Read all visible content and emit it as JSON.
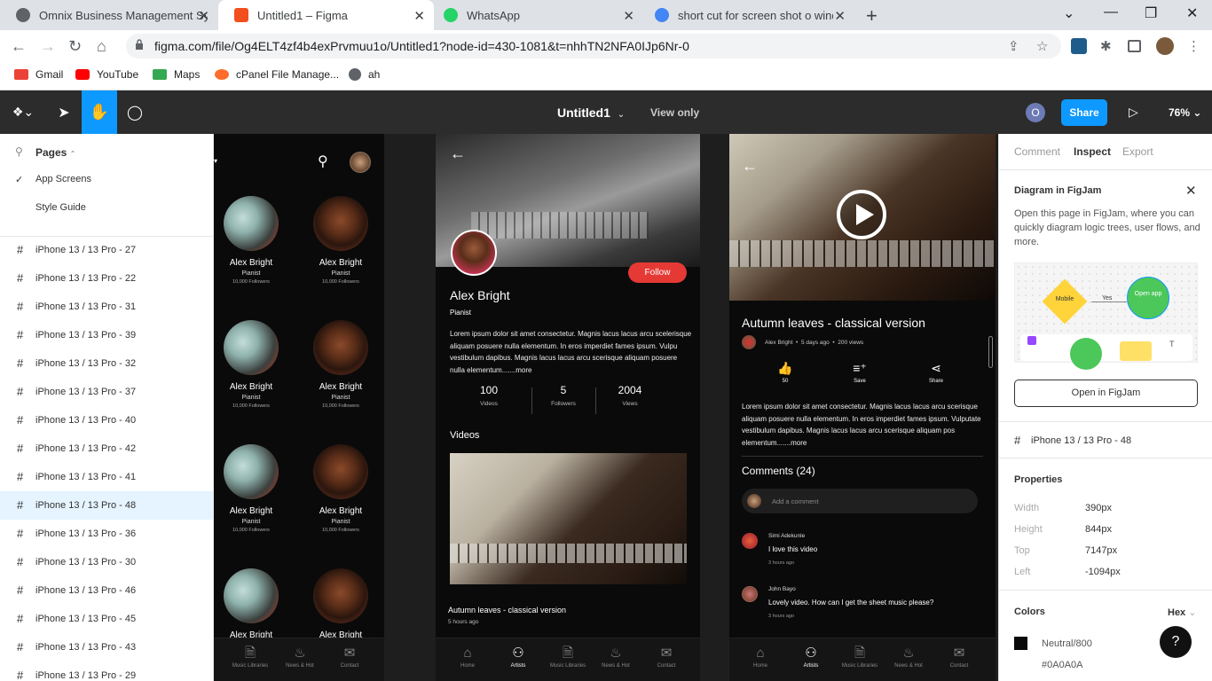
{
  "browser": {
    "tabs": [
      {
        "title": "Omnix Business Management Sy",
        "color": "#5f6368"
      },
      {
        "title": "Untitled1 – Figma",
        "color": "#f24e1e"
      },
      {
        "title": "WhatsApp",
        "color": "#25d366"
      },
      {
        "title": "short cut for screen shot o windo",
        "color": "#4285f4"
      }
    ],
    "url": "figma.com/file/Og4ELT4zf4b4exPrvmuu1o/Untitled1?node-id=430-1081&t=nhhTN2NFA0IJp6Nr-0",
    "bookmarks": [
      "Gmail",
      "YouTube",
      "Maps",
      "cPanel File Manage...",
      "ah"
    ]
  },
  "figma": {
    "file_name": "Untitled1",
    "mode": "View only",
    "avatar_initial": "O",
    "share_label": "Share",
    "zoom": "76%"
  },
  "left_panel": {
    "pages_label": "Pages",
    "pages": [
      "App Screens",
      "Style Guide"
    ],
    "frames": [
      "iPhone 13 / 13 Pro - 27",
      "iPhone 13 / 13 Pro - 22",
      "iPhone 13 / 13 Pro - 31",
      "iPhone 13 / 13 Pro - 39",
      "iPhone 13 / 13 Pro - 32",
      "iPhone 13 / 13 Pro - 37",
      "iPhone 13 / 13 Pro - 40",
      "iPhone 13 / 13 Pro - 42",
      "iPhone 13 / 13 Pro - 41",
      "iPhone 13 / 13 Pro - 48",
      "iPhone 13 / 13 Pro - 36",
      "iPhone 13 / 13 Pro - 30",
      "iPhone 13 / 13 Pro - 46",
      "iPhone 13 / 13 Pro - 45",
      "iPhone 13 / 13 Pro - 43",
      "iPhone 13 / 13 Pro - 29"
    ],
    "selected_frame": "iPhone 13 / 13 Pro - 48"
  },
  "screen1": {
    "artist_name": "Alex Bright",
    "artist_role": "Pianist",
    "artist_followers": "10,000 Followers",
    "nav": [
      "Music Libraries",
      "News & Hot",
      "Contact"
    ]
  },
  "screen2": {
    "name": "Alex Bright",
    "role": "Pianist",
    "follow": "Follow",
    "bio": "Lorem ipsum dolor sit amet consectetur. Magnis lacus lacus arcu scelerisque aliquam posuere nulla elementum. In eros imperdiet fames ipsum. Vulpu vestibulum dapibus. Magnis lacus lacus arcu scerisque aliquam posuere nulla elementum.......more",
    "stats": [
      {
        "value": "100",
        "label": "Videos"
      },
      {
        "value": "5",
        "label": "Followers"
      },
      {
        "value": "2004",
        "label": "Views"
      }
    ],
    "videos_heading": "Videos",
    "video_title": "Autumn leaves - classical version",
    "video_time": "5 hours ago",
    "nav": [
      "Home",
      "Artists",
      "Music Libraries",
      "News & Hot",
      "Contact"
    ]
  },
  "screen3": {
    "title": "Autumn leaves - classical version",
    "author": "Alex Bright",
    "time": "5 days ago",
    "views": "200 views",
    "actions": [
      {
        "label": "50",
        "icon": "thumbs-up-icon"
      },
      {
        "label": "Save",
        "icon": "playlist-add-icon"
      },
      {
        "label": "Share",
        "icon": "share-icon"
      }
    ],
    "desc": "Lorem ipsum dolor sit amet consectetur. Magnis lacus lacus arcu scerisque aliquam posuere nulla elementum. In eros imperdiet fames ipsum. Vulputate vestibulum dapibus. Magnis lacus lacus arcu scerisque aliquam pos elementum.......more",
    "comments_heading": "Comments (24)",
    "comment_placeholder": "Add a comment",
    "comments": [
      {
        "name": "Simi Adekunle",
        "text": "I love this video",
        "time": "3 hours ago"
      },
      {
        "name": "John Bayo",
        "text": "Lovely video. How can I get the sheet music please?",
        "time": "3 hours ago"
      }
    ],
    "nav": [
      "Home",
      "Artists",
      "Music Libraries",
      "News & Hot",
      "Contact"
    ]
  },
  "right_panel": {
    "tabs": [
      "Comment",
      "Inspect",
      "Export"
    ],
    "active_tab": "Inspect",
    "figjam_title": "Diagram in FigJam",
    "figjam_desc": "Open this page in FigJam, where you can quickly diagram logic trees, user flows, and more.",
    "figjam_diagram": {
      "node1": "Mobile",
      "edge": "Yes",
      "node2": "Open app"
    },
    "open_button": "Open in FigJam",
    "frame_name": "iPhone 13 / 13 Pro - 48",
    "properties_heading": "Properties",
    "properties": [
      {
        "key": "Width",
        "value": "390px"
      },
      {
        "key": "Height",
        "value": "844px"
      },
      {
        "key": "Top",
        "value": "7147px"
      },
      {
        "key": "Left",
        "value": "-1094px"
      }
    ],
    "colors_heading": "Colors",
    "color_format": "Hex",
    "color_name": "Neutral/800",
    "color_hex": "#0A0A0A",
    "help": "?"
  }
}
